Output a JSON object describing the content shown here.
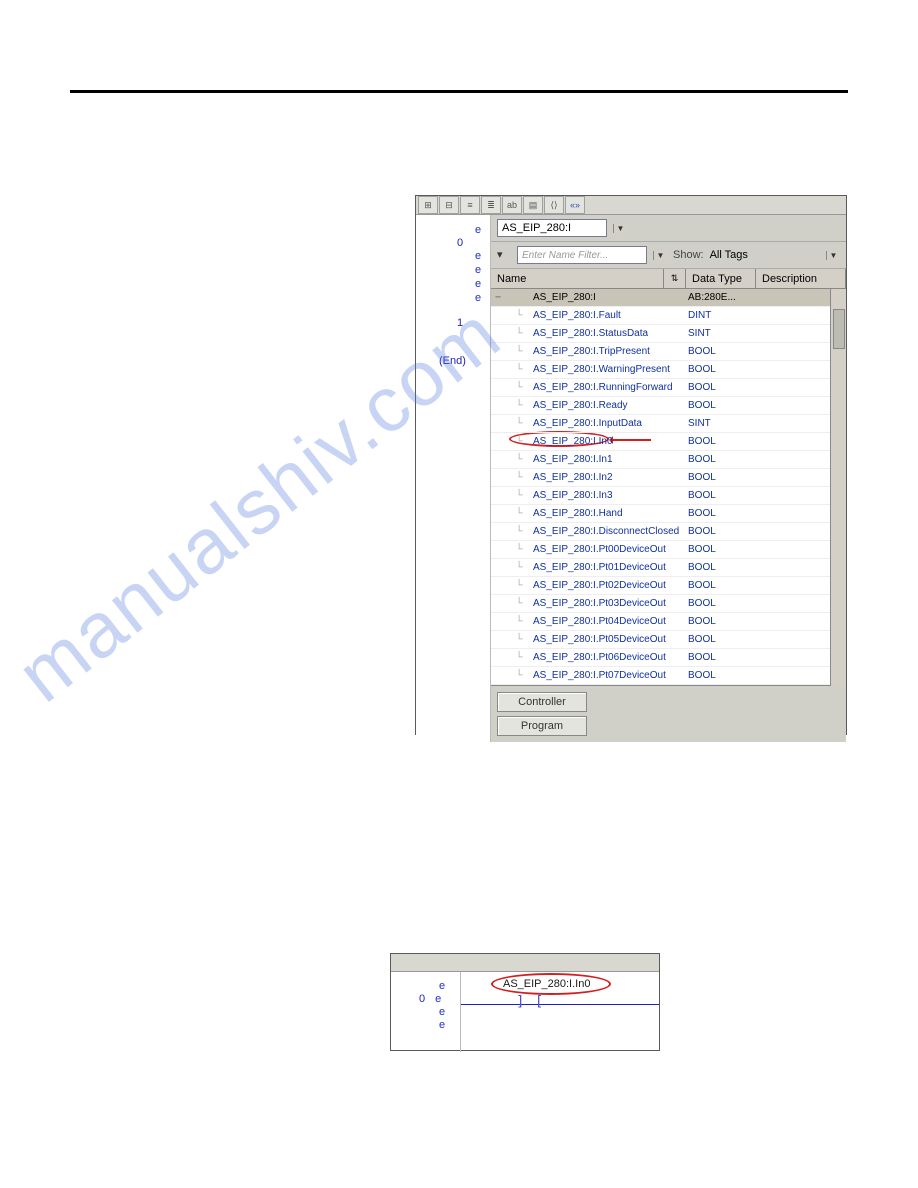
{
  "rung_gutter": {
    "r0": "0",
    "r1": "1",
    "end": "(End)",
    "e": "e"
  },
  "selected_tag": "AS_EIP_280:I",
  "filter_placeholder": "Enter Name Filter...",
  "show_label": "Show:",
  "show_value": "All Tags",
  "columns": {
    "name": "Name",
    "type": "Data Type",
    "desc": "Description"
  },
  "tags": [
    {
      "name": "AS_EIP_280:I",
      "type": "AB:280E...",
      "hl": true
    },
    {
      "name": "AS_EIP_280:I.Fault",
      "type": "DINT"
    },
    {
      "name": "AS_EIP_280:I.StatusData",
      "type": "SINT"
    },
    {
      "name": "AS_EIP_280:I.TripPresent",
      "type": "BOOL"
    },
    {
      "name": "AS_EIP_280:I.WarningPresent",
      "type": "BOOL"
    },
    {
      "name": "AS_EIP_280:I.RunningForward",
      "type": "BOOL"
    },
    {
      "name": "AS_EIP_280:I.Ready",
      "type": "BOOL"
    },
    {
      "name": "AS_EIP_280:I.InputData",
      "type": "SINT"
    },
    {
      "name": "AS_EIP_280:I.In0",
      "type": "BOOL"
    },
    {
      "name": "AS_EIP_280:I.In1",
      "type": "BOOL"
    },
    {
      "name": "AS_EIP_280:I.In2",
      "type": "BOOL"
    },
    {
      "name": "AS_EIP_280:I.In3",
      "type": "BOOL"
    },
    {
      "name": "AS_EIP_280:I.Hand",
      "type": "BOOL"
    },
    {
      "name": "AS_EIP_280:I.DisconnectClosed",
      "type": "BOOL"
    },
    {
      "name": "AS_EIP_280:I.Pt00DeviceOut",
      "type": "BOOL"
    },
    {
      "name": "AS_EIP_280:I.Pt01DeviceOut",
      "type": "BOOL"
    },
    {
      "name": "AS_EIP_280:I.Pt02DeviceOut",
      "type": "BOOL"
    },
    {
      "name": "AS_EIP_280:I.Pt03DeviceOut",
      "type": "BOOL"
    },
    {
      "name": "AS_EIP_280:I.Pt04DeviceOut",
      "type": "BOOL"
    },
    {
      "name": "AS_EIP_280:I.Pt05DeviceOut",
      "type": "BOOL"
    },
    {
      "name": "AS_EIP_280:I.Pt06DeviceOut",
      "type": "BOOL"
    },
    {
      "name": "AS_EIP_280:I.Pt07DeviceOut",
      "type": "BOOL"
    }
  ],
  "buttons": {
    "controller": "Controller",
    "program": "Program"
  },
  "fig2": {
    "tag": "AS_EIP_280:I.In0",
    "contact": "] ["
  },
  "watermark": "manualshiv.com"
}
